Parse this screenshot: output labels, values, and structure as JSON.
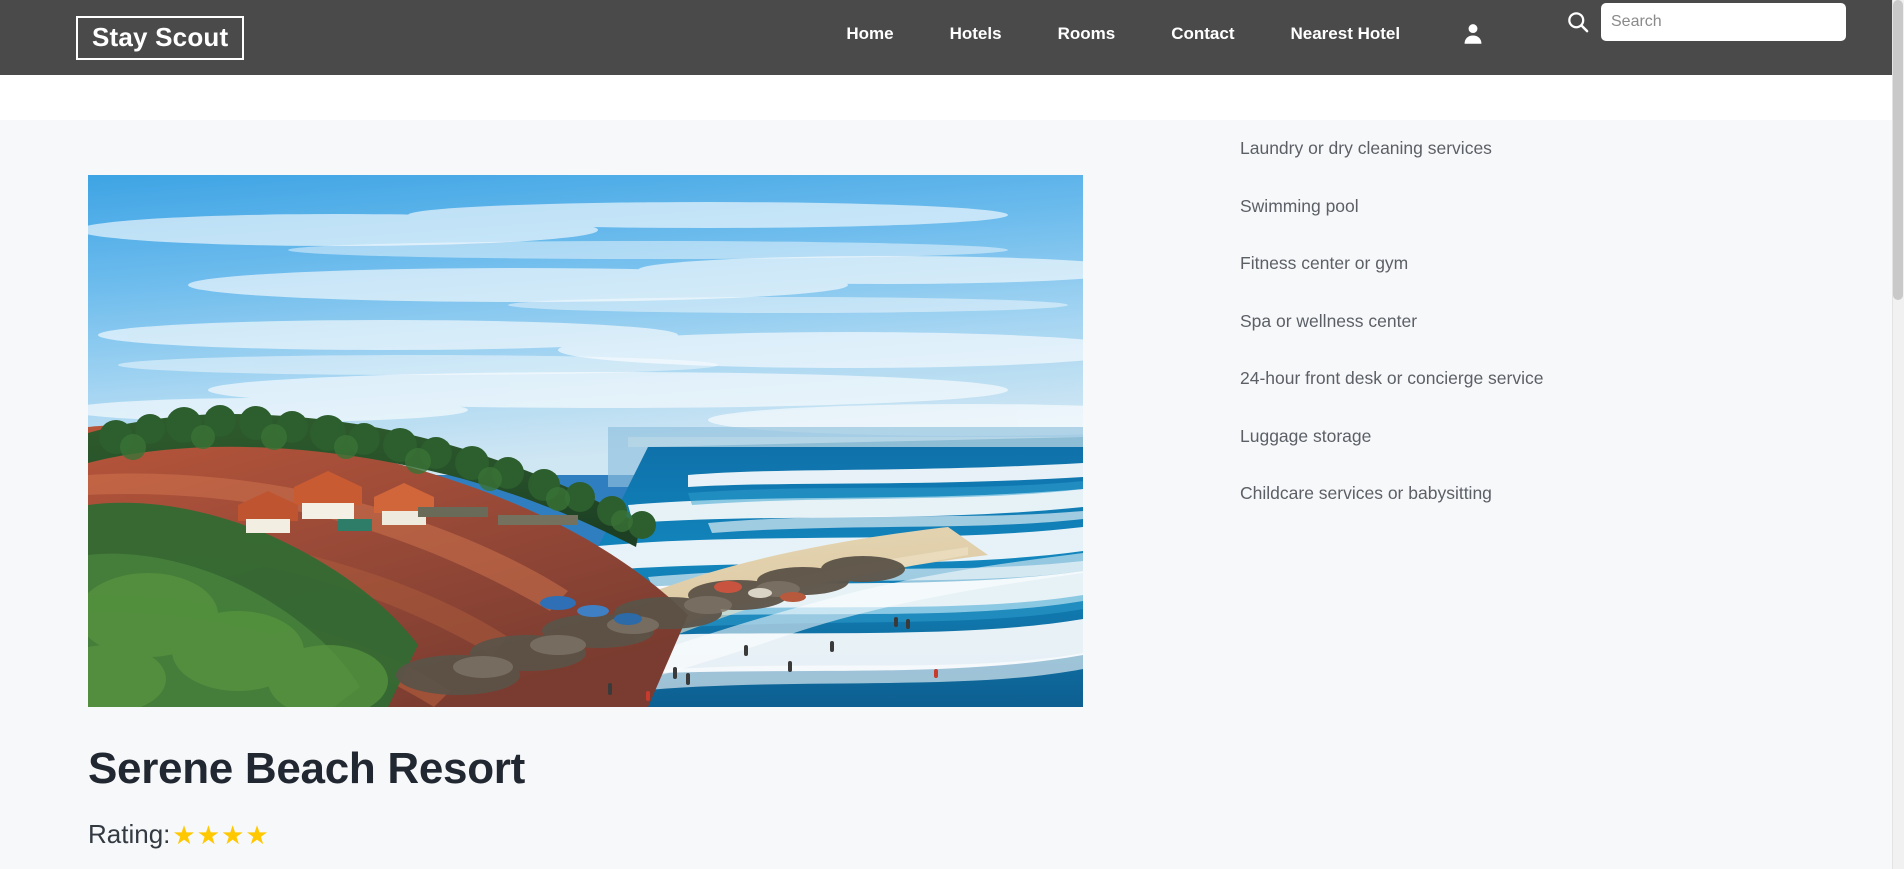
{
  "navbar": {
    "brand": "Stay Scout",
    "links": [
      {
        "label": "Home",
        "name": "nav-link-home"
      },
      {
        "label": "Hotels",
        "name": "nav-link-hotels"
      },
      {
        "label": "Rooms",
        "name": "nav-link-rooms"
      },
      {
        "label": "Contact",
        "name": "nav-link-contact"
      },
      {
        "label": "Nearest Hotel",
        "name": "nav-link-nearest-hotel"
      }
    ],
    "account_icon": "user-icon",
    "search_icon": "search-icon",
    "search": {
      "placeholder": "Search",
      "value": ""
    },
    "background_color": "#4a4a4a",
    "text_color": "#ffffff"
  },
  "hotel": {
    "name": "Serene Beach Resort",
    "rating_label": "Rating:",
    "rating_value": 4,
    "rating_stars": "★★★★",
    "star_color": "#FFC800",
    "photo_alt": "Tropical cliff beach with palm trees, red laterite cliffs, sandy shore and turquoise ocean waves"
  },
  "amenities": {
    "items": [
      "Laundry or dry cleaning services",
      "Swimming pool",
      "Fitness center or gym",
      "Spa or wellness center",
      "24-hour front desk or concierge service",
      "Luggage storage",
      "Childcare services or babysitting"
    ]
  },
  "theme": {
    "page_background": "#f7f8fa",
    "strip_background": "#ffffff",
    "title_color": "#222831",
    "amenity_color": "#5c6066"
  }
}
